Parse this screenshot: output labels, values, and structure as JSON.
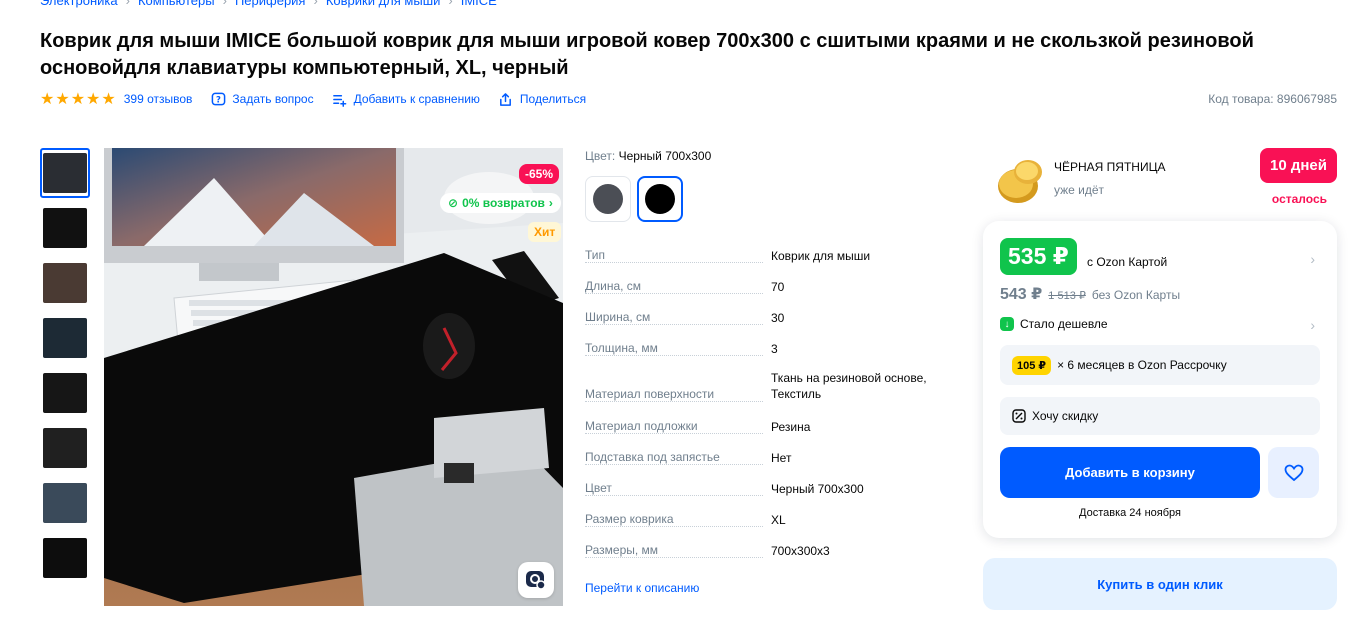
{
  "breadcrumbs": [
    "Электроника",
    "Компьютеры",
    "Периферия",
    "Коврики для мыши",
    "IMICE"
  ],
  "title": "Коврик для мыши IMICE большой коврик для мыши игровой ковер 700x300 с сшитыми краями и не скользкой резиновой основойдля клавиатуры компьютерный, XL, черный",
  "rating": {
    "stars": 5,
    "reviews_label": "399 отзывов"
  },
  "actions": {
    "ask": "Задать вопрос",
    "compare": "Добавить к сравнению",
    "share": "Поделиться"
  },
  "sku": "Код товара: 896067985",
  "thumbnails": [
    {
      "name": "thumb-desk-mat",
      "color": "#2a2d33",
      "active": true
    },
    {
      "name": "thumb-mat-size",
      "color": "#111111"
    },
    {
      "name": "thumb-hand-on-mat",
      "color": "#4a3a33"
    },
    {
      "name": "thumb-features",
      "color": "#1d2a35"
    },
    {
      "name": "thumb-rolled-mat",
      "color": "#161616"
    },
    {
      "name": "thumb-mat-edge",
      "color": "#202020"
    },
    {
      "name": "thumb-desk-setup",
      "color": "#3a4a5a"
    },
    {
      "name": "thumb-mat-flat",
      "color": "#0d0d0d"
    }
  ],
  "badges": {
    "discount": "-65%",
    "returns": "0% возвратов",
    "hit": "Хит"
  },
  "color": {
    "label": "Цвет:",
    "value": "Черный 700x300",
    "swatches": [
      "#4b4e55",
      "#000000"
    ]
  },
  "specs": [
    {
      "k": "Тип",
      "v": "Коврик для мыши"
    },
    {
      "k": "Длина, см",
      "v": "70"
    },
    {
      "k": "Ширина, см",
      "v": "30"
    },
    {
      "k": "Толщина, мм",
      "v": "3"
    },
    {
      "k": "Материал поверхности",
      "v": "Ткань на резиновой основе, Текстиль"
    },
    {
      "k": "Материал подложки",
      "v": "Резина"
    },
    {
      "k": "Подставка под запястье",
      "v": "Нет"
    },
    {
      "k": "Цвет",
      "v": "Черный 700x300"
    },
    {
      "k": "Размер коврика",
      "v": "XL"
    },
    {
      "k": "Размеры, мм",
      "v": "700x300x3"
    }
  ],
  "specs_link": "Перейти к описанию",
  "promo": {
    "title": "ЧЁРНАЯ ПЯТНИЦА",
    "subtitle": "уже идёт",
    "days": "10 дней",
    "left": "осталось"
  },
  "price": {
    "ozon_card": "535 ₽",
    "ozon_card_label": "с Ozon Картой",
    "regular": "543 ₽",
    "old": "1 513 ₽",
    "regular_label": "без Ozon Карты",
    "cheaper": "Стало дешевле",
    "installment_amount": "105 ₽",
    "installment_text": "× 6 месяцев в Ozon Рассрочку",
    "want_discount": "Хочу скидку"
  },
  "cart_button": "Добавить в корзину",
  "delivery": "Доставка 24 ноября",
  "one_click": "Купить в один клик",
  "colors": {
    "accent": "#005bff",
    "green": "#10c44c",
    "red": "#f91155",
    "muted": "#707f8d"
  }
}
